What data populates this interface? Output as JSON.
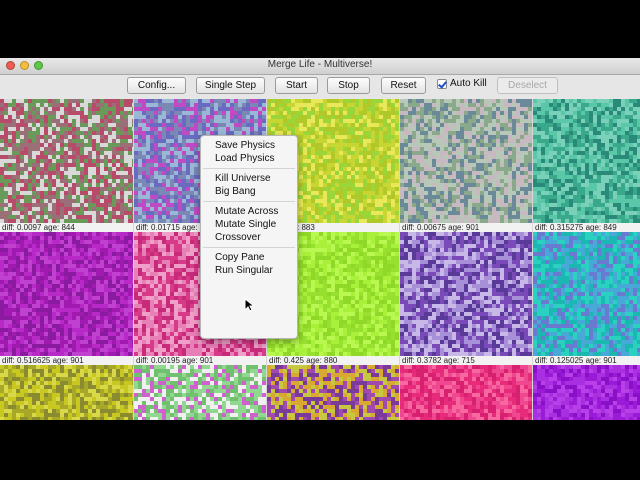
{
  "window": {
    "title": "Merge Life - Multiverse!"
  },
  "toolbar": {
    "buttons": [
      {
        "label": "Config...",
        "enabled": true
      },
      {
        "label": "Single Step",
        "enabled": true
      },
      {
        "label": "Start",
        "enabled": true
      },
      {
        "label": "Stop",
        "enabled": true
      },
      {
        "label": "Reset",
        "enabled": true
      },
      {
        "label": "Deselect",
        "enabled": false
      }
    ],
    "auto_kill": {
      "label": "Auto Kill",
      "checked": true
    }
  },
  "panes": [
    {
      "label": "diff: 0.0097 age: 844",
      "colors": [
        "#9a6f78",
        "#6a9a5a",
        "#d9d9d9",
        "#b84a6a"
      ]
    },
    {
      "label": "diff: 0.01715 age: 901",
      "colors": [
        "#7a88b6",
        "#c04ac4",
        "#9ab8d6",
        "#6a6ac0"
      ]
    },
    {
      "label": "E-4 age: 883",
      "colors": [
        "#c8d634",
        "#9ad63a",
        "#e8e85a",
        "#b0c828"
      ]
    },
    {
      "label": "diff: 0.00675 age: 901",
      "colors": [
        "#8aa88a",
        "#b8c8b8",
        "#6a8a9a",
        "#c8b8c0"
      ]
    },
    {
      "label": "diff: 0.315275 age: 849",
      "colors": [
        "#3aa88a",
        "#5ac8a8",
        "#2a8a7a",
        "#7ad0b8"
      ]
    },
    {
      "label": "diff: 0.516625 age: 901",
      "colors": [
        "#a01ab0",
        "#b82ac8",
        "#8a1aa0",
        "#c040d0"
      ]
    },
    {
      "label": "diff: 0.00195 age: 901",
      "colors": [
        "#d83a8a",
        "#f0a0c8",
        "#c82a7a",
        "#e880b8"
      ]
    },
    {
      "label": "diff: 0.425 age: 880",
      "colors": [
        "#a8f03a",
        "#98e030",
        "#b8f850",
        "#90d828"
      ]
    },
    {
      "label": "diff: 0.3782 age: 715",
      "colors": [
        "#7a4ab8",
        "#a890d8",
        "#5a3a98",
        "#c8b8e8"
      ]
    },
    {
      "label": "diff: 0.125025 age: 901",
      "colors": [
        "#2ad0c0",
        "#6a7ad0",
        "#1ab8b0",
        "#48a8d8"
      ]
    },
    {
      "label": "",
      "colors": [
        "#c8c820",
        "#a8a828",
        "#d8d848",
        "#8a8a30"
      ]
    },
    {
      "label": "",
      "colors": [
        "#90d890",
        "#f0f0f0",
        "#d060d0",
        "#70c070"
      ]
    },
    {
      "label": "",
      "colors": [
        "#a04ab0",
        "#d8a830",
        "#7a3a9a",
        "#c8c840"
      ]
    },
    {
      "label": "",
      "colors": [
        "#e82a7a",
        "#f04890",
        "#d82070",
        "#f868a0"
      ]
    },
    {
      "label": "",
      "colors": [
        "#9a1ad8",
        "#a830e0",
        "#8a10c8",
        "#b840e8"
      ]
    }
  ],
  "context_menu": {
    "groups": [
      [
        "Save Physics",
        "Load Physics"
      ],
      [
        "Kill Universe",
        "Big Bang"
      ],
      [
        "Mutate Across",
        "Mutate Single",
        "Crossover"
      ],
      [
        "Copy Pane",
        "Run Singular"
      ]
    ]
  }
}
